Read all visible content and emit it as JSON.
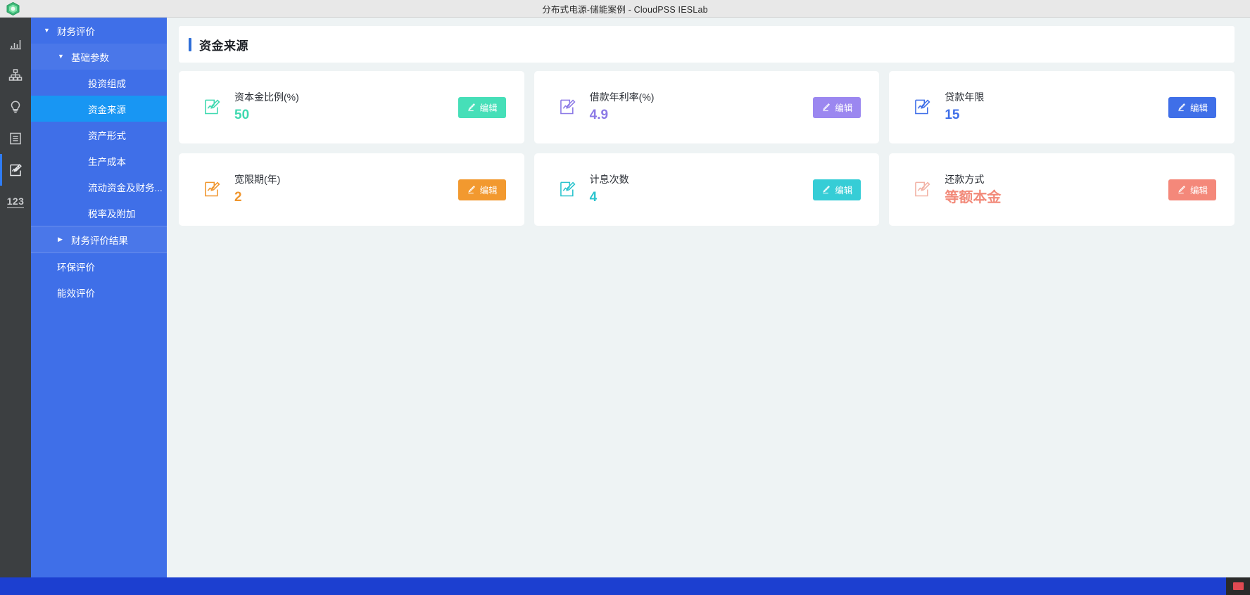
{
  "window": {
    "title": "分布式电源-储能案例 - CloudPSS IESLab",
    "logo_icon": "cloudpss-cube-logo"
  },
  "rail": {
    "items": [
      {
        "name": "bar-chart-icon",
        "label": "图表"
      },
      {
        "name": "hierarchy-icon",
        "label": "拓扑"
      },
      {
        "name": "lightbulb-icon",
        "label": "方案"
      },
      {
        "name": "document-list-icon",
        "label": "清单"
      },
      {
        "name": "edit-chart-icon",
        "label": "评价",
        "active": true
      },
      {
        "name": "numbers-123-icon",
        "label": "123"
      }
    ]
  },
  "sidebar": {
    "items": [
      {
        "label": "财务评价",
        "level": 0,
        "caret": "▼",
        "selected": false
      },
      {
        "label": "基础参数",
        "level": 1,
        "caret": "▼",
        "selected": false
      },
      {
        "label": "投资组成",
        "level": 2,
        "caret": "",
        "selected": false
      },
      {
        "label": "资金来源",
        "level": 2,
        "caret": "",
        "selected": true
      },
      {
        "label": "资产形式",
        "level": 2,
        "caret": "",
        "selected": false
      },
      {
        "label": "生产成本",
        "level": 2,
        "caret": "",
        "selected": false
      },
      {
        "label": "流动资金及财务...",
        "level": 2,
        "caret": "",
        "selected": false
      },
      {
        "label": "税率及附加",
        "level": 2,
        "caret": "",
        "selected": false
      },
      {
        "label": "财务评价结果",
        "level": 1,
        "caret": "▶",
        "selected": false
      },
      {
        "label": "环保评价",
        "level": 0,
        "caret": "",
        "selected": false
      },
      {
        "label": "能效评价",
        "level": 0,
        "caret": "",
        "selected": false
      }
    ]
  },
  "page": {
    "title": "资金来源",
    "accent_color": "#2f6fd8"
  },
  "cards": [
    {
      "label": "资本金比例(%)",
      "value": "50",
      "color": "#3fd9b0",
      "button_label": "编辑",
      "button_color": "#46dfb8",
      "icon": "edit-chart-icon",
      "name": "capital-ratio"
    },
    {
      "label": "借款年利率(%)",
      "value": "4.9",
      "color": "#8c7ae6",
      "button_label": "编辑",
      "button_color": "#9b87f0",
      "icon": "edit-chart-icon",
      "name": "loan-annual-rate"
    },
    {
      "label": "贷款年限",
      "value": "15",
      "color": "#3f6fe8",
      "button_label": "编辑",
      "button_color": "#3f6fe8",
      "icon": "edit-chart-icon",
      "name": "loan-term"
    },
    {
      "label": "宽限期(年)",
      "value": "2",
      "color": "#f0962e",
      "button_label": "编辑",
      "button_color": "#f2992f",
      "icon": "edit-chart-icon",
      "name": "grace-period"
    },
    {
      "label": "计息次数",
      "value": "4",
      "color": "#2bc4ce",
      "button_label": "编辑",
      "button_color": "#36cdd6",
      "icon": "edit-chart-icon",
      "name": "interest-count"
    },
    {
      "label": "还款方式",
      "value": "等额本金",
      "color": "#f28a7a",
      "button_label": "编辑",
      "button_color": "#f4887a",
      "icon": "edit-chart-icon",
      "name": "repayment-method"
    }
  ],
  "taskbar": {
    "color": "#1c3fd0",
    "tray_icon": "tray-chip-icon"
  }
}
